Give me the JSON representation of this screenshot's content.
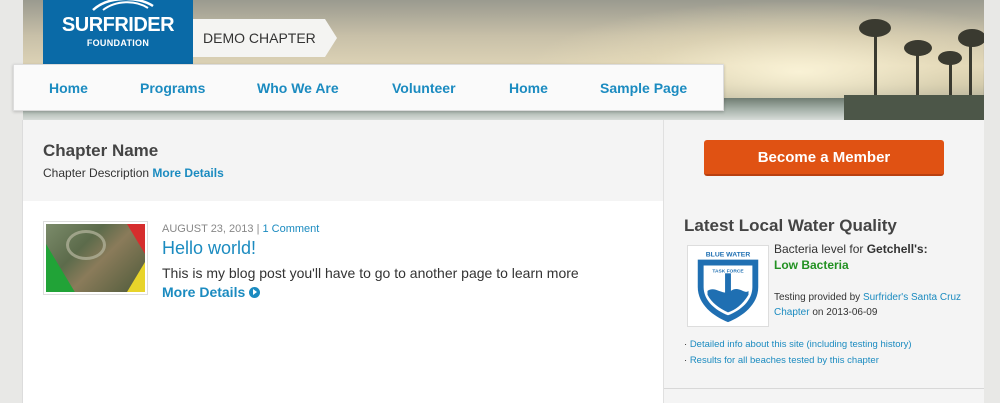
{
  "header": {
    "logo_name": "SURFRIDER",
    "logo_sub": "FOUNDATION",
    "chapter_tag": "DEMO CHAPTER"
  },
  "nav": {
    "items": [
      {
        "label": "Home"
      },
      {
        "label": "Programs"
      },
      {
        "label": "Who We Are"
      },
      {
        "label": "Volunteer"
      },
      {
        "label": "Home"
      },
      {
        "label": "Sample Page"
      }
    ]
  },
  "chapter": {
    "title": "Chapter Name",
    "description": "Chapter Description",
    "more_link": "More Details"
  },
  "post": {
    "date": "AUGUST 23, 2013",
    "separator": "|",
    "comments": "1 Comment",
    "title": "Hello world!",
    "excerpt": "This is my blog post you'll have to go to another page to learn more",
    "more_link": "More Details"
  },
  "sidebar": {
    "member_button": "Become a Member",
    "water_quality_title": "Latest Local Water Quality",
    "bacteria_prefix": "Bacteria level for",
    "beach_name": "Getchell's:",
    "bacteria_status": "Low Bacteria",
    "provided_prefix": "Testing provided by",
    "provider_link": "Surfrider's Santa Cruz Chapter",
    "provided_date": "on 2013-06-09",
    "links": [
      {
        "label": "Detailed info about this site (including testing history)"
      },
      {
        "label": "Results for all beaches tested by this chapter"
      }
    ],
    "badge_text_top": "BLUE WATER",
    "badge_text_sub": "TASK FORCE"
  },
  "colors": {
    "brand_blue": "#0a6aa7",
    "link_blue": "#1b8bc0",
    "cta_orange": "#e05213",
    "status_green": "#229122"
  }
}
